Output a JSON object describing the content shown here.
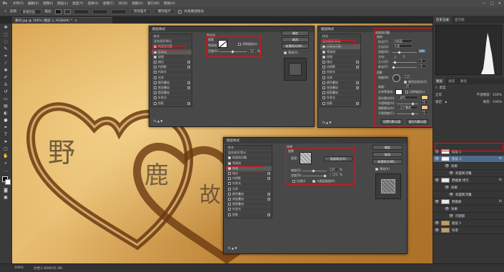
{
  "app": {
    "logo": "Ps",
    "menu": [
      "文件(F)",
      "编辑(E)",
      "图像(I)",
      "图层(L)",
      "类型(Y)",
      "选择(S)",
      "滤镜(T)",
      "3D(D)",
      "视图(V)",
      "窗口(W)",
      "帮助(H)"
    ],
    "window_controls": [
      "—",
      "□",
      "✕"
    ]
  },
  "options_bar": {
    "tool_icon": "transform-icon",
    "label1": "选择:",
    "select_value": "填满图层",
    "label2": "描边:",
    "btn_a": "添加锚点",
    "btn_b": "删除锚点",
    "checkbox_label": "约束路径拖动"
  },
  "document": {
    "tab_title": "素材.jpg @ 100% (图层 3, RGB/8#) *",
    "close": "×"
  },
  "status": {
    "zoom": "100%",
    "doc": "文档:1.85M/20.3M"
  },
  "right_panel": {
    "tabs": [
      "历史记录",
      "直方图"
    ],
    "layers_tabs": [
      "图层",
      "通道",
      "路径"
    ],
    "layers_kind": "类型",
    "blend_mode": "正常",
    "opacity_label": "不透明度:",
    "opacity": "100%",
    "lock_label": "锁定:",
    "fill_label": "填充:",
    "fill": "100%",
    "layers": [
      {
        "name": "图层 2",
        "type": "white",
        "fx": false,
        "sel": false
      },
      {
        "name": "图层 3",
        "type": "white",
        "fx": true,
        "sel": true
      },
      {
        "name": "效果",
        "type": "sub",
        "fx": false,
        "sel": false
      },
      {
        "name": "斜面和浮雕",
        "type": "sub2",
        "fx": false,
        "sel": false
      },
      {
        "name": "野鹿故 拷贝",
        "type": "text",
        "fx": true,
        "sel": false
      },
      {
        "name": "效果",
        "type": "sub",
        "fx": false,
        "sel": false
      },
      {
        "name": "斜面和浮雕",
        "type": "sub2",
        "fx": false,
        "sel": false
      },
      {
        "name": "野鹿故",
        "type": "text",
        "fx": true,
        "sel": false
      },
      {
        "name": "效果",
        "type": "sub",
        "fx": false,
        "sel": false
      },
      {
        "name": "内阴影",
        "type": "sub2",
        "fx": false,
        "sel": false
      },
      {
        "name": "图层 1",
        "type": "sand",
        "fx": false,
        "sel": false
      },
      {
        "name": "背景",
        "type": "sand",
        "fx": false,
        "sel": false
      }
    ]
  },
  "dialog_common": {
    "title": "图层样式",
    "items": [
      {
        "label": "样式",
        "cb": false,
        "plus": false
      },
      {
        "label": "混合选项:默认",
        "cb": false,
        "plus": false
      },
      {
        "label": "斜面和浮雕",
        "cb": true,
        "plus": false
      },
      {
        "label": "等高线",
        "cb": true,
        "plus": false
      },
      {
        "label": "纹理",
        "cb": true,
        "plus": false
      },
      {
        "label": "描边",
        "cb": false,
        "plus": true
      },
      {
        "label": "内阴影",
        "cb": false,
        "plus": true
      },
      {
        "label": "内发光",
        "cb": false,
        "plus": false
      },
      {
        "label": "光泽",
        "cb": false,
        "plus": false
      },
      {
        "label": "颜色叠加",
        "cb": false,
        "plus": true
      },
      {
        "label": "渐变叠加",
        "cb": false,
        "plus": true
      },
      {
        "label": "图案叠加",
        "cb": false,
        "plus": false
      },
      {
        "label": "外发光",
        "cb": false,
        "plus": false
      },
      {
        "label": "投影",
        "cb": false,
        "plus": true
      }
    ],
    "ok": "确定",
    "cancel": "取消",
    "new_style": "新建样式(W)...",
    "preview": "预览(V)"
  },
  "dialog1": {
    "section": "等高线",
    "sub": "图素",
    "contour_label": "等高线:",
    "aa": "消除锯齿(L)",
    "range_label": "范围(R):",
    "range_val": "50",
    "pct": "%"
  },
  "dialog2": {
    "section": "斜面和浮雕",
    "structure": "结构",
    "style_label": "样式(T):",
    "style_val": "内斜面",
    "technique_label": "方法(Q):",
    "technique_val": "平滑",
    "depth_label": "深度(D):",
    "depth_val": "100",
    "direction_label": "方向:",
    "up": "上",
    "down": "下",
    "size_label": "大小(Z):",
    "size_val": "5",
    "soften_label": "软化(F):",
    "soften_val": "0",
    "shading": "阴影",
    "angle_label": "角度(N):",
    "angle_val": "120",
    "global_light": "使用全局光(G)",
    "altitude_label": "高度:",
    "altitude_val": "30",
    "gloss_label": "光泽等高线:",
    "aa": "消除锯齿(L)",
    "highlight_label": "高光模式(H):",
    "highlight_mode": "滤色",
    "highlight_opacity_label": "不透明度(O):",
    "highlight_opacity": "75",
    "shadow_label": "阴影模式(A):",
    "shadow_mode": "正片叠底",
    "shadow_opacity_label": "不透明度(C):",
    "shadow_opacity": "75",
    "default_btn": "设置为默认值",
    "reset_btn": "复位为默认值",
    "highlight_color": "#f3c98e",
    "shadow_color": "#e8c08a"
  },
  "dialog3": {
    "section": "纹理",
    "sub": "图素",
    "pattern_label": "图案:",
    "snap_btn": "贴紧原点(A)",
    "scale_label": "缩放(S):",
    "scale_val": "100",
    "depth_label": "深度(D):",
    "depth_val": "+100",
    "invert": "反相(I)",
    "link": "与图层链接(K)",
    "pct": "%"
  },
  "canvas_text": {
    "char1": "野",
    "char2": "鹿",
    "char3": "故"
  },
  "colors": {
    "highlight": "#e0121b",
    "selection": "#4e6b8c"
  }
}
